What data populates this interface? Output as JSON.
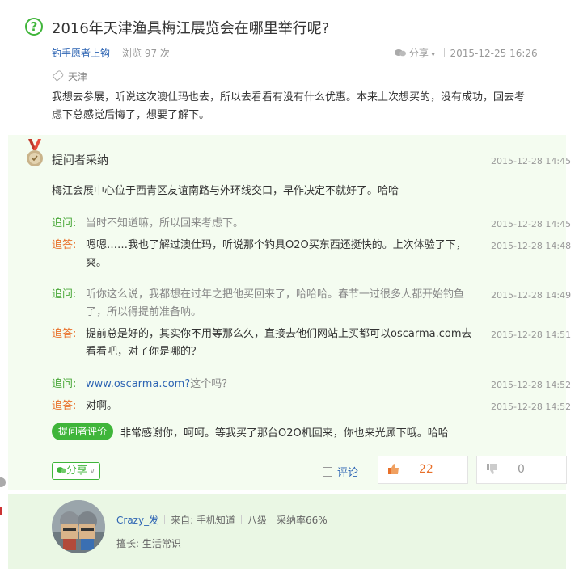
{
  "question": {
    "icon": "question-mark-icon",
    "icon_glyph": "?",
    "title": "2016年天津渔具梅江展览会在哪里举行呢?",
    "author": "钓手愿者上钩",
    "views": "浏览 97 次",
    "share_label": "分享",
    "time": "2015-12-25 16:26",
    "tag": "天津",
    "body": "我想去参展，听说这次澳仕玛也去，所以去看看有没有什么优惠。本来上次想买的，没有成功，回去考虑下总感觉后悔了，想要了解下。"
  },
  "answer": {
    "adopted_label": "提问者采纳",
    "time": "2015-12-28 14:45",
    "body": "梅江会展中心位于西青区友谊南路与外环线交口，早作决定不就好了。哈哈",
    "ask_label": "追问:",
    "reply_label": "追答:",
    "thread": [
      {
        "text": "当时不知道嘛，所以回来考虑下。",
        "time": "2015-12-28 14:45"
      },
      {
        "text": "嗯嗯……我也了解过澳仕玛，听说那个钓具O2O买东西还挺快的。上次体验了下，爽。",
        "time": "2015-12-28 14:48"
      },
      {
        "text": "听你这么说，我都想在过年之把他买回来了，哈哈哈。春节一过很多人都开始钓鱼了，所以得提前准备呐。",
        "time": "2015-12-28 14:49"
      },
      {
        "text": "提前总是好的，其实你不用等那么久，直接去他们网站上买都可以oscarma.com去看看吧，对了你是哪的？",
        "time": "2015-12-28 14:51"
      },
      {
        "link": "www.oscarma.com?",
        "text": "这个吗？",
        "time": "2015-12-28 14:52"
      },
      {
        "text": "对啊。",
        "time": "2015-12-28 14:52"
      }
    ],
    "evaluation_badge": "提问者评价",
    "evaluation_text": "非常感谢你，呵呵。等我买了那台O2O机回来，你也来光顾下哦。哈哈",
    "share_label": "分享",
    "comment_label": "评论",
    "upvotes": "22",
    "downvotes": "0"
  },
  "user": {
    "name": "Crazy_发",
    "source": "来自:  手机知道",
    "level": "八级",
    "adopt_rate": "采纳率66%",
    "expertise": "擅长:  生活常识"
  },
  "colors": {
    "accent_green": "#3fb53a",
    "link_blue": "#2d64b3",
    "reply_orange": "#e8702a",
    "answer_bg": "#f4fcf0",
    "user_bg": "#eaf7e4"
  }
}
